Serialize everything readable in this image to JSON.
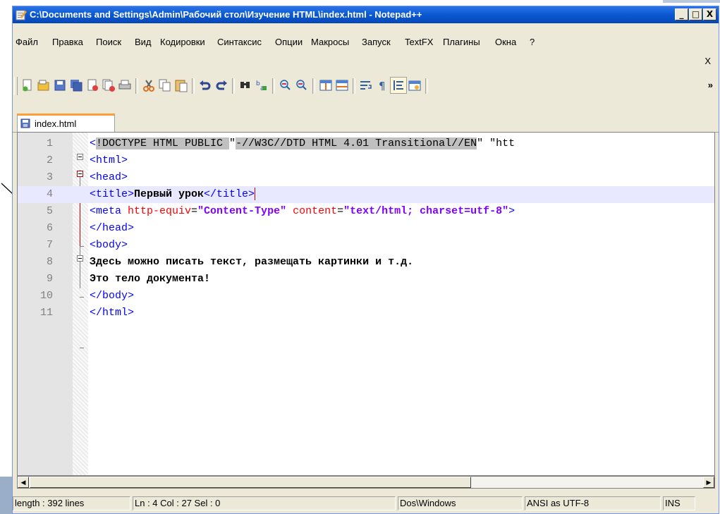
{
  "window": {
    "title": "C:\\Documents and Settings\\Admin\\Рабочий стол\\Изучение HTML\\index.html - Notepad++",
    "buttons": [
      "_",
      "□",
      "X"
    ]
  },
  "menu": {
    "items": [
      "Файл",
      "Правка",
      "Поиск",
      "Вид",
      "Кодировки",
      "Синтаксис",
      "Опции",
      "Макросы",
      "Запуск",
      "TextFX",
      "Плагины",
      "Окна",
      "?"
    ],
    "close": "X"
  },
  "toolbar": {
    "buttons": [
      "new-file-icon",
      "open-file-icon",
      "save-icon",
      "save-all-icon",
      "close-icon",
      "close-all-icon",
      "print-icon",
      "cut-icon",
      "copy-icon",
      "paste-icon",
      "undo-icon",
      "redo-icon",
      "find-icon",
      "replace-icon",
      "zoom-in-icon",
      "zoom-out-icon",
      "sync-vertical-icon",
      "sync-horizontal-icon",
      "word-wrap-icon",
      "show-all-chars-icon",
      "indent-guide-icon",
      "user-lang-icon"
    ],
    "more": "»"
  },
  "tab": {
    "label": "index.html"
  },
  "editor": {
    "lines": [
      {
        "n": "1",
        "segments": [
          [
            "tag",
            "<"
          ],
          [
            "sel",
            "!DOCTYPE HTML PUBLIC "
          ],
          [
            "",
            "\""
          ],
          [
            "sel",
            "-//W3C//DTD HTML 4.01 Transitional//EN"
          ],
          [
            "",
            "\" \"htt"
          ]
        ]
      },
      {
        "n": "2",
        "segments": [
          [
            "tag",
            "<html>"
          ]
        ]
      },
      {
        "n": "3",
        "segments": [
          [
            "tag",
            "<head>"
          ]
        ]
      },
      {
        "n": "4",
        "segments": [
          [
            "tag",
            "<title>"
          ],
          [
            "txt",
            "Первый урок"
          ],
          [
            "tag",
            "</title>"
          ]
        ]
      },
      {
        "n": "5",
        "segments": [
          [
            "tag",
            "<meta "
          ],
          [
            "attr",
            "http-equiv"
          ],
          [
            "",
            "="
          ],
          [
            "str",
            "\"Content-Type\""
          ],
          [
            "attr",
            " content"
          ],
          [
            "",
            "="
          ],
          [
            "str",
            "\"text/html; charset=utf-8\""
          ],
          [
            "tag",
            ">"
          ]
        ]
      },
      {
        "n": "6",
        "segments": [
          [
            "tag",
            "</head>"
          ]
        ]
      },
      {
        "n": "7",
        "segments": [
          [
            "tag",
            "<body>"
          ]
        ]
      },
      {
        "n": "8",
        "segments": [
          [
            "txt",
            "Здесь можно писать текст, размещать картинки и т.д."
          ]
        ]
      },
      {
        "n": "9",
        "segments": [
          [
            "txt",
            "Это тело документа!"
          ]
        ]
      },
      {
        "n": "10",
        "segments": [
          [
            "tag",
            "</body>"
          ]
        ]
      },
      {
        "n": "11",
        "segments": [
          [
            "tag",
            "</html>"
          ]
        ]
      }
    ],
    "current_line": 4
  },
  "status": {
    "length": "length : 392   lines",
    "position": "Ln : 4    Col : 27    Sel : 0",
    "eol": "Dos\\Windows",
    "encoding": "ANSI as UTF-8",
    "mode": "INS"
  }
}
